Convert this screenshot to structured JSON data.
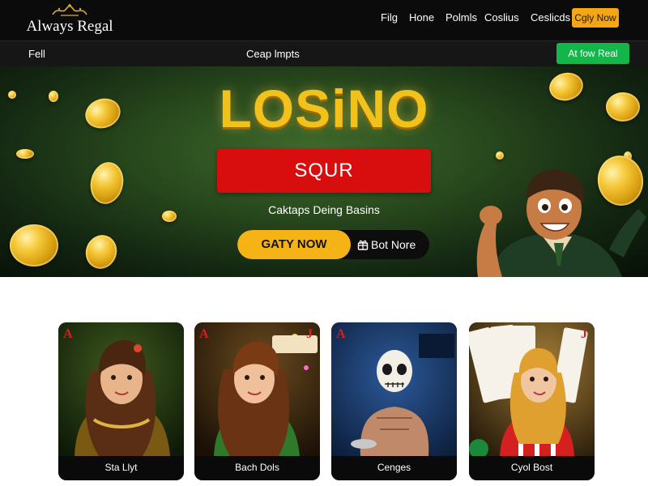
{
  "header": {
    "brand": "Always Regal",
    "nav": [
      "Filg",
      "Hone",
      "Polmls",
      "Coslius",
      "Ceslicds"
    ],
    "cta": "Cgly Now"
  },
  "subnav": {
    "left": "Fell",
    "center": "Ceap lmpts",
    "cta": "At fow Real"
  },
  "hero": {
    "title": "LOSiNO",
    "banner": "SQUR",
    "subtitle": "Caktaps Deing Basins",
    "primary_button": "GATY NOW",
    "secondary_button": "Bot Nore"
  },
  "cards": [
    {
      "label": "Sta Llyt"
    },
    {
      "label": "Bach Dols"
    },
    {
      "label": "Cenges"
    },
    {
      "label": "Cyol Bost"
    }
  ],
  "colors": {
    "accent_gold": "#f5b315",
    "nav_cta": "#f5a614",
    "green_cta": "#14b649",
    "banner_red": "#d80d0d",
    "title_gold": "#f2c21c"
  }
}
